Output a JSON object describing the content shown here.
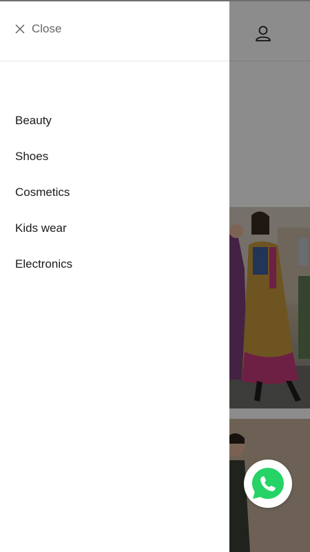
{
  "drawer": {
    "close_label": "Close",
    "menu_items": [
      {
        "label": "Beauty"
      },
      {
        "label": "Shoes"
      },
      {
        "label": "Cosmetics"
      },
      {
        "label": "Kids wear"
      },
      {
        "label": "Electronics"
      }
    ]
  },
  "icons": {
    "close": "close-icon",
    "account": "user-icon",
    "chat": "whatsapp-icon"
  },
  "colors": {
    "overlay": "#000000",
    "whatsapp_green": "#25D366",
    "text": "#1a1a1a",
    "muted_text": "#666666"
  }
}
